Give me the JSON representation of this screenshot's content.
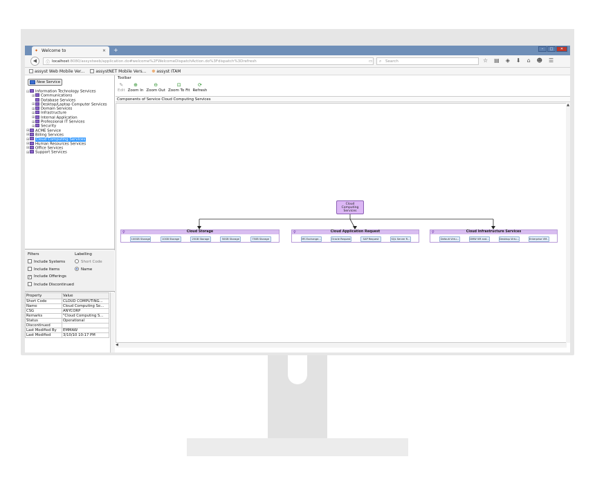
{
  "browser": {
    "tab_title": "Welcome to",
    "url_host": "localhost",
    "url_rest": ":8080/assystweb/application.do#welcome%2FWelcomeDispatchAction.do%3Fdispatch%3Drefresh",
    "search_placeholder": "Search",
    "bookmarks": [
      "assyst Web Mobile Ver...",
      "assystNET Mobile Vers...",
      "assyst ITAM"
    ]
  },
  "app": {
    "new_service_label": "New Service",
    "tree": [
      {
        "label": "Information Technology Services",
        "depth": 0,
        "sign": "⊟"
      },
      {
        "label": "Communications",
        "depth": 1,
        "sign": "⊞"
      },
      {
        "label": "Database Services",
        "depth": 1,
        "sign": ""
      },
      {
        "label": "Desktop/Laptop Computer Services",
        "depth": 1,
        "sign": "⊞"
      },
      {
        "label": "Domain Services",
        "depth": 1,
        "sign": "⊞"
      },
      {
        "label": "Infrastructure",
        "depth": 1,
        "sign": "⊞"
      },
      {
        "label": "Internal Application",
        "depth": 1,
        "sign": "⊞"
      },
      {
        "label": "Professional IT Services",
        "depth": 1,
        "sign": "⊞"
      },
      {
        "label": "Security",
        "depth": 1,
        "sign": "⊞"
      },
      {
        "label": "ACME Service",
        "depth": 0,
        "sign": "⊞"
      },
      {
        "label": "Billing Services",
        "depth": 0,
        "sign": "⊞"
      },
      {
        "label": "Cloud Computing Services",
        "depth": 0,
        "sign": "⊞",
        "selected": true
      },
      {
        "label": "Human Resources Services",
        "depth": 0,
        "sign": "⊞"
      },
      {
        "label": "Office Services",
        "depth": 0,
        "sign": "⊞"
      },
      {
        "label": "Support Services",
        "depth": 0,
        "sign": "⊞"
      }
    ],
    "filters": {
      "filters_label": "Filters",
      "labelling_label": "Labelling",
      "include_systems": "Include Systems",
      "include_items": "Include Items",
      "include_offerings": "Include Offerings",
      "include_discontinued": "Include Discontinued",
      "short_code": "Short Code",
      "name": "Name"
    },
    "properties": {
      "header_property": "Property",
      "header_value": "Value",
      "rows": [
        [
          "Short Code",
          "CLOUD COMPUTING..."
        ],
        [
          "Name",
          "Cloud Computing Se..."
        ],
        [
          "CSG",
          "ANYCORP"
        ],
        [
          "Remarks",
          "\"Cloud Computing S..."
        ],
        [
          "Status",
          "Operational"
        ],
        [
          "Discontinued",
          ""
        ],
        [
          "Last Modified By",
          "EMMAW"
        ],
        [
          "Last Modified",
          "3/10/10 10:17 PM"
        ]
      ]
    },
    "toolbar": {
      "label": "Toolbar",
      "edit": "Edit",
      "zoom_in": "Zoom In",
      "zoom_out": "Zoom Out",
      "zoom_fit": "Zoom To Fit",
      "refresh": "Refresh"
    },
    "components_label": "Components of Service Cloud Computing Services",
    "diagram": {
      "root": "Cloud Computing Services",
      "groups": [
        {
          "title": "Cloud Storage",
          "items": [
            "100GB Storage",
            "10GB Storage",
            "25GB Storage",
            "50GB Storage",
            "750B Storage"
          ]
        },
        {
          "title": "Cloud Application Request",
          "items": [
            "MS Exchange...",
            "Oracle Request",
            "SAP Request",
            "SQL Server R..."
          ]
        },
        {
          "title": "Cloud Infrastructure Services",
          "items": [
            "Default Virtu...",
            "DMW VM and...",
            "Desktop Virtu...",
            "Enterprise VM..."
          ]
        }
      ]
    }
  }
}
